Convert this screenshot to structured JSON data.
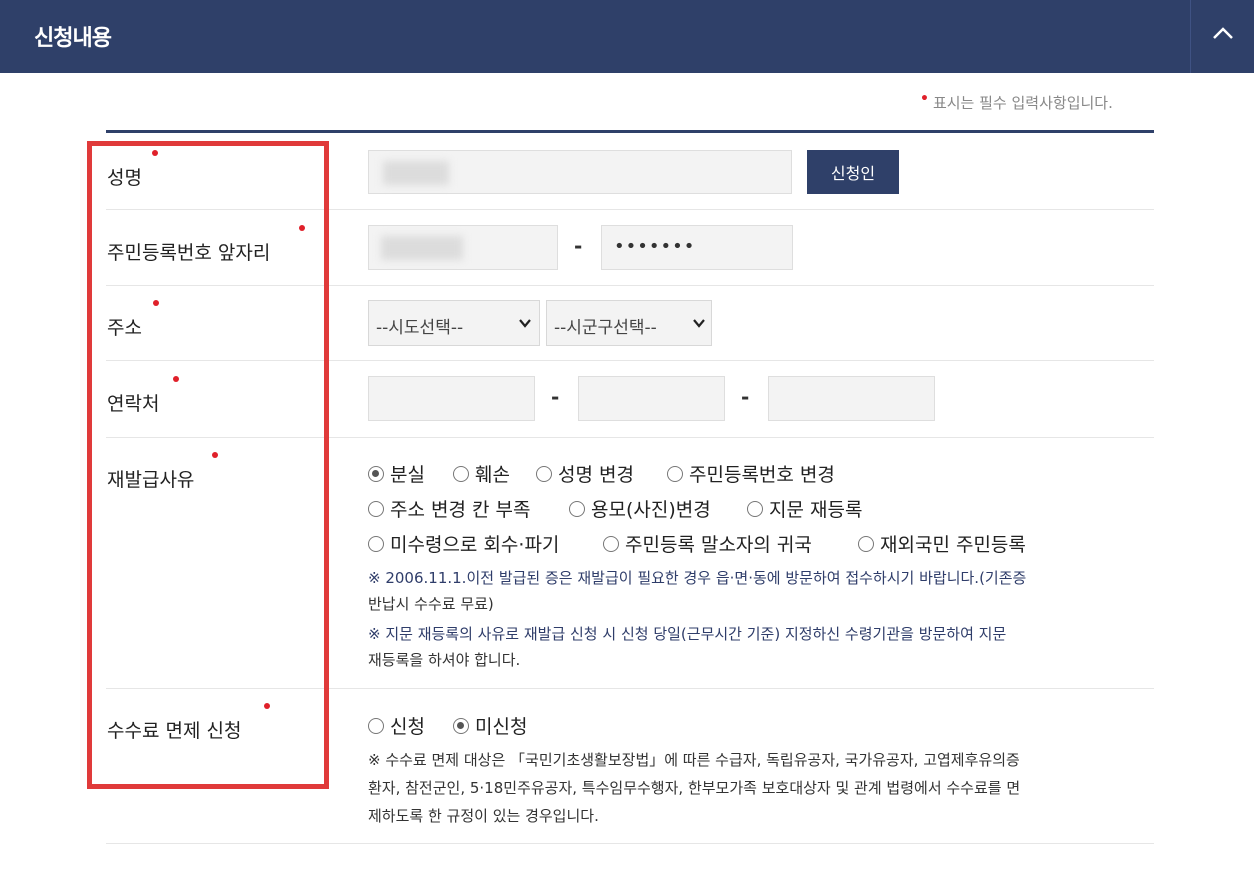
{
  "section": {
    "title": "신청내용",
    "collapse_icon": "chevron-up-icon"
  },
  "required_note": "표시는 필수 입력사항입니다.",
  "colors": {
    "navy": "#2f4069",
    "required_dot": "#e0202a",
    "highlight_box": "#e03a3a",
    "input_bg": "#f3f3f3"
  },
  "fields": {
    "name": {
      "label": "성명",
      "value": "",
      "button_label": "신청인"
    },
    "rrn": {
      "label": "주민등록번호 앞자리",
      "front_value": "",
      "dash": "-",
      "back_masked": "•••••••"
    },
    "address": {
      "label": "주소",
      "sido_selected": "--시도선택--",
      "sigungu_selected": "--시군구선택--"
    },
    "contact": {
      "label": "연락처",
      "dash1": "-",
      "dash2": "-"
    },
    "reason": {
      "label": "재발급사유",
      "options": [
        "분실",
        "훼손",
        "성명 변경",
        "주민등록번호 변경",
        "주소 변경 칸 부족",
        "용모(사진)변경",
        "지문 재등록",
        "미수령으로 회수·파기",
        "주민등록 말소자의 귀국",
        "재외국민 주민등록"
      ],
      "selected": "분실",
      "notes": [
        "※ 2006.11.1.이전 발급된 증은 재발급이 필요한 경우 읍·면·동에 방문하여 접수하시기 바랍니다.(기존증",
        "반납시 수수료 무료)",
        "※ 지문 재등록의 사유로 재발급 신청 시 신청 당일(근무시간 기준) 지정하신 수령기관을 방문하여 지문",
        "재등록을 하셔야 합니다."
      ]
    },
    "fee": {
      "label": "수수료 면제 신청",
      "options": [
        "신청",
        "미신청"
      ],
      "selected": "미신청",
      "notes": [
        "※ 수수료 면제 대상은 「국민기초생활보장법」에 따른 수급자, 독립유공자, 국가유공자, 고엽제후유의증",
        "환자, 참전군인, 5·18민주유공자, 특수임무수행자, 한부모가족 보호대상자 및 관계 법령에서 수수료를 면",
        "제하도록 한 규정이 있는 경우입니다."
      ]
    }
  }
}
